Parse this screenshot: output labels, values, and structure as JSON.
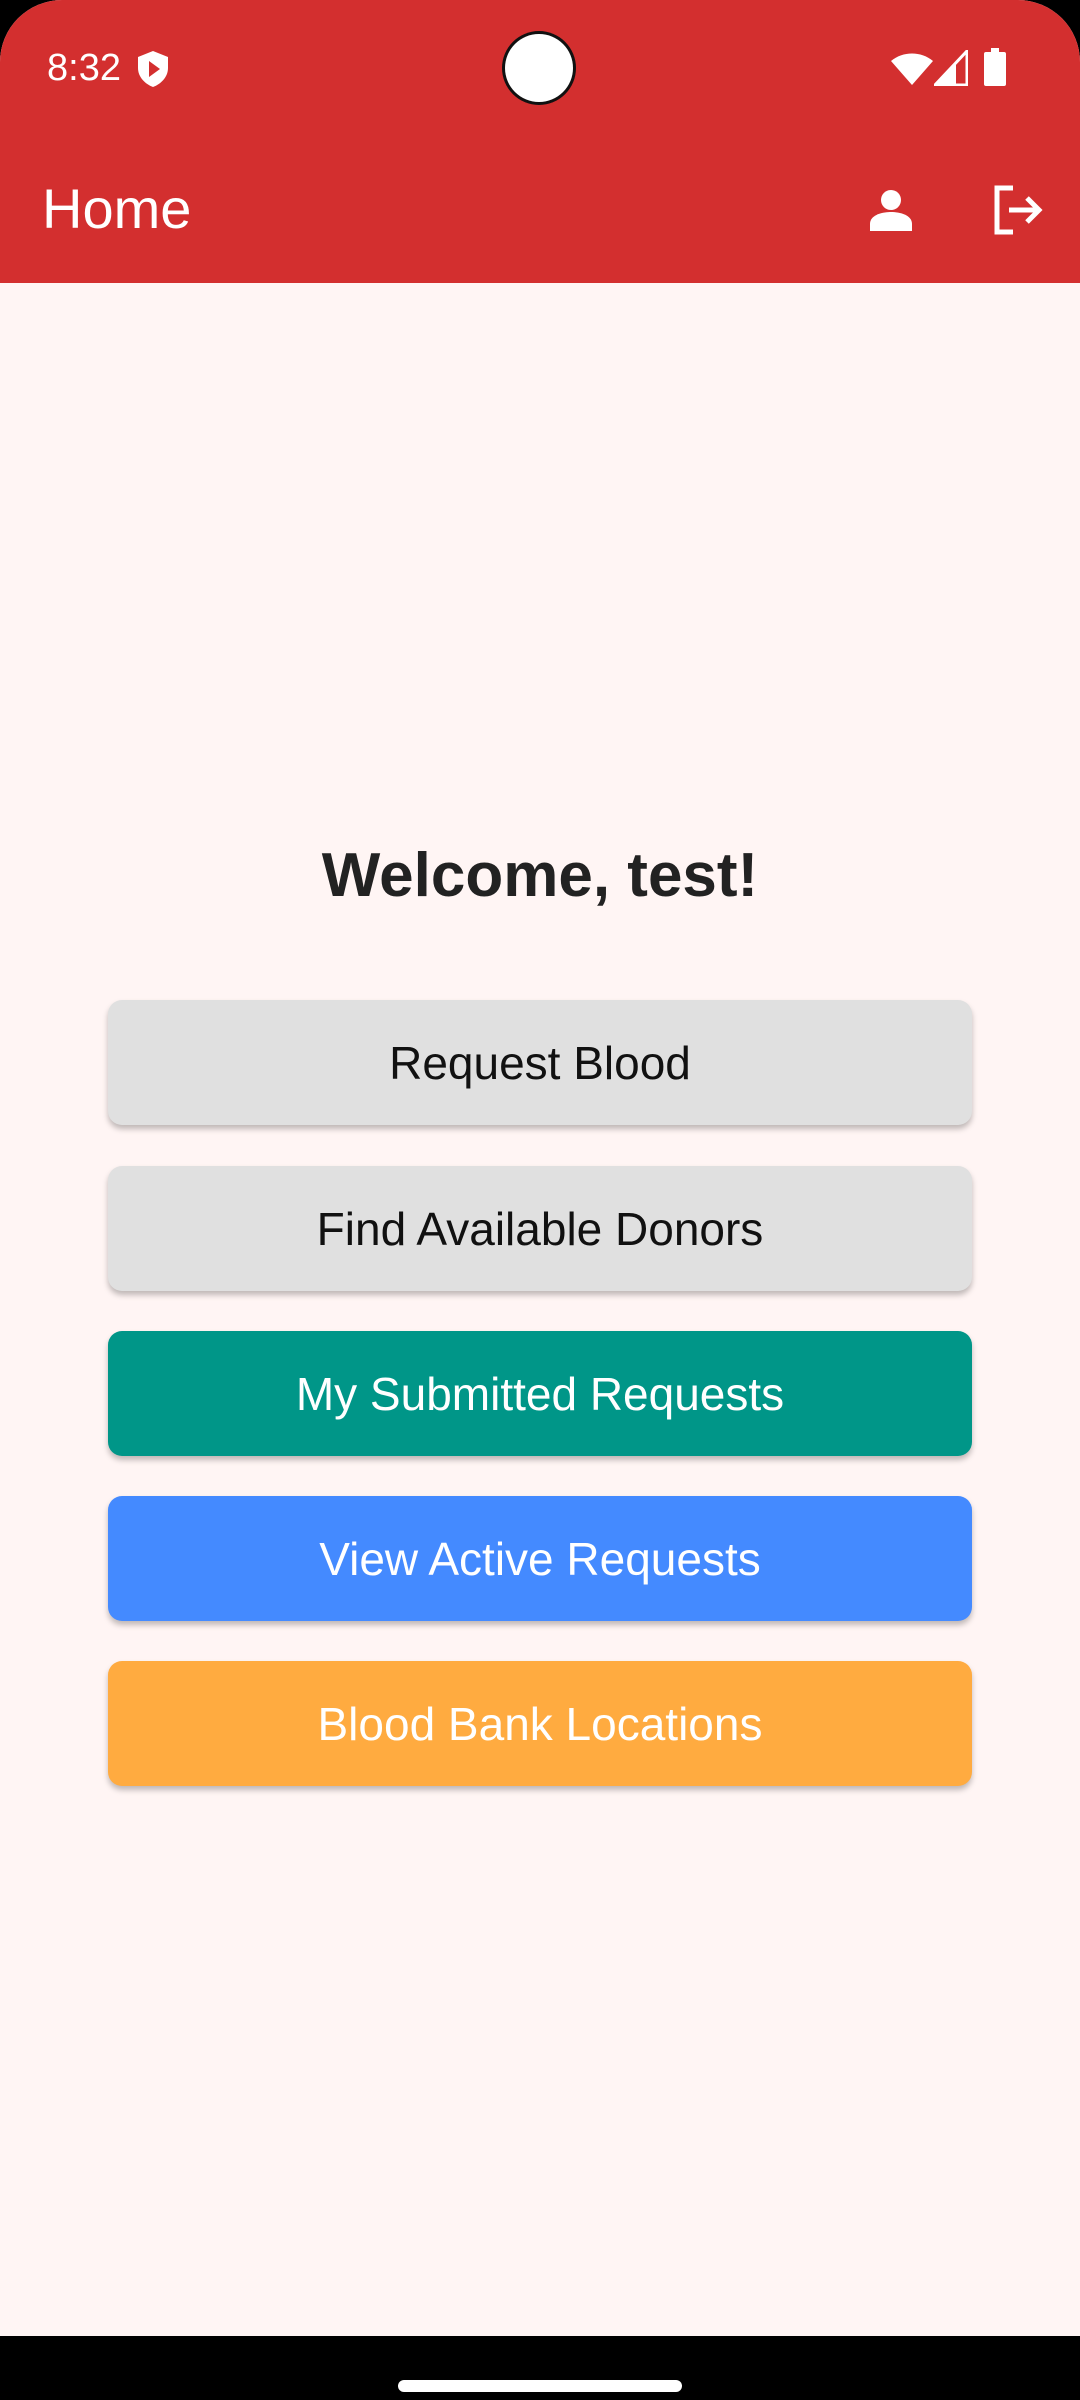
{
  "status_bar": {
    "time": "8:32",
    "icons": [
      "shield-icon",
      "wifi-icon",
      "signal-icon",
      "battery-icon"
    ]
  },
  "app_bar": {
    "title": "Home",
    "actions": [
      "profile-icon",
      "logout-icon"
    ],
    "background_color": "#d32f2f"
  },
  "main": {
    "welcome_text": "Welcome, test!",
    "buttons": [
      {
        "label": "Request Blood",
        "color": "#e0e0e0"
      },
      {
        "label": "Find Available Donors",
        "color": "#e0e0e0"
      },
      {
        "label": "My Submitted Requests",
        "color": "#009688"
      },
      {
        "label": "View Active Requests",
        "color": "#448aff"
      },
      {
        "label": "Blood Bank Locations",
        "color": "#ffab40"
      }
    ]
  },
  "colors": {
    "page_background": "#fff5f4"
  }
}
